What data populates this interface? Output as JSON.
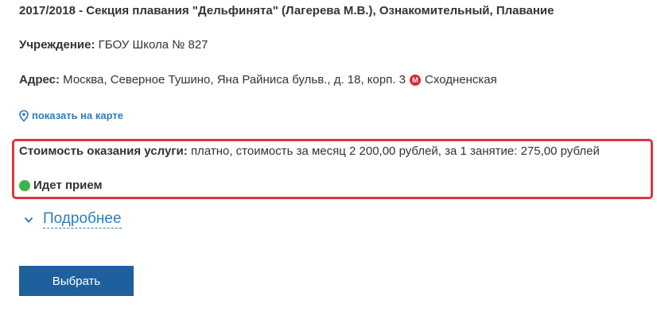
{
  "section": {
    "title": "2017/2018 - Секция плавания \"Дельфинята\" (Лагерева М.В.), Ознакомительный, Плавание"
  },
  "institution": {
    "label": "Учреждение:",
    "value": "ГБОУ Школа № 827"
  },
  "address": {
    "label": "Адрес:",
    "value": "Москва, Северное Тушино, Яна Райниса бульв., д. 18, корп. 3",
    "metro_icon": "metro-icon",
    "metro_letter": "M",
    "metro_station": "Сходненская"
  },
  "map_link": {
    "icon": "map-pin-icon",
    "label": "показать на карте"
  },
  "cost": {
    "label": "Стоимость оказания услуги:",
    "value": "платно, стоимость за месяц 2 200,00 рублей, за 1 занятие: 275,00 рублей"
  },
  "status": {
    "icon": "green-dot-icon",
    "label": "Идет прием",
    "color": "#3cb44b"
  },
  "more": {
    "icon": "chevron-down-icon",
    "label": "Подробнее"
  },
  "select_button": {
    "label": "Выбрать"
  },
  "colors": {
    "link": "#2d7dbf",
    "button": "#1e5f9e",
    "highlight_border": "#d9363e",
    "metro": "#d8282f"
  }
}
